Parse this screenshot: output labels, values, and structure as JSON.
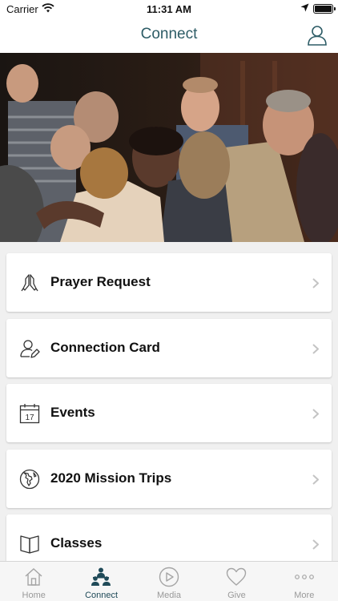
{
  "status_bar": {
    "carrier": "Carrier",
    "time": "11:31 AM"
  },
  "header": {
    "title": "Connect",
    "accent_color": "#2d5c66"
  },
  "menu": {
    "items": [
      {
        "label": "Prayer Request",
        "icon": "praying-hands-icon"
      },
      {
        "label": "Connection Card",
        "icon": "user-edit-icon"
      },
      {
        "label": "Events",
        "icon": "calendar-icon",
        "icon_text": "17"
      },
      {
        "label": "2020 Mission Trips",
        "icon": "globe-icon"
      },
      {
        "label": "Classes",
        "icon": "book-icon"
      }
    ]
  },
  "tab_bar": {
    "active": "Connect",
    "active_color": "#1f4a58",
    "inactive_color": "#999999",
    "tabs": [
      {
        "label": "Home",
        "icon": "home-icon"
      },
      {
        "label": "Connect",
        "icon": "people-icon"
      },
      {
        "label": "Media",
        "icon": "play-icon"
      },
      {
        "label": "Give",
        "icon": "heart-icon"
      },
      {
        "label": "More",
        "icon": "more-dots-icon"
      }
    ]
  }
}
